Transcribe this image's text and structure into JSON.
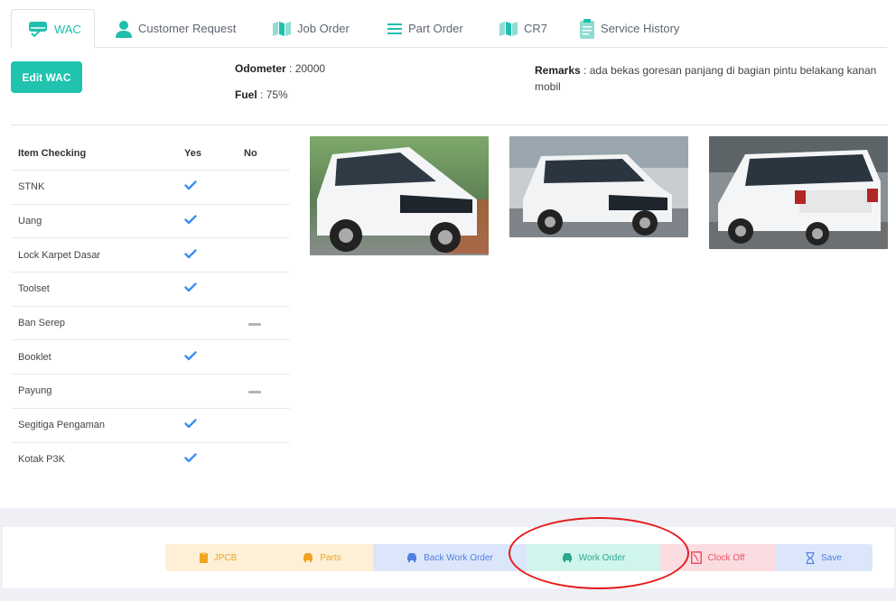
{
  "tabs": [
    {
      "label": "WAC",
      "icon": "car-check-icon",
      "active": true
    },
    {
      "label": "Customer Request",
      "icon": "person-icon"
    },
    {
      "label": "Job Order",
      "icon": "map-icon"
    },
    {
      "label": "Part Order",
      "icon": "list-icon"
    },
    {
      "label": "CR7",
      "icon": "map-icon"
    },
    {
      "label": "Service History",
      "icon": "clipboard-icon"
    }
  ],
  "edit_button": "Edit WAC",
  "odometer": {
    "label": "Odometer",
    "value": "20000"
  },
  "fuel": {
    "label": "Fuel",
    "value": "75%"
  },
  "remarks": {
    "label": "Remarks",
    "value": "ada bekas goresan panjang di bagian pintu belakang kanan mobil"
  },
  "checklist": {
    "headers": {
      "item": "Item Checking",
      "yes": "Yes",
      "no": "No"
    },
    "rows": [
      {
        "item": "STNK",
        "status": "yes"
      },
      {
        "item": "Uang",
        "status": "yes"
      },
      {
        "item": "Lock Karpet Dasar",
        "status": "yes"
      },
      {
        "item": "Toolset",
        "status": "yes"
      },
      {
        "item": "Ban Serep",
        "status": "no"
      },
      {
        "item": "Booklet",
        "status": "yes"
      },
      {
        "item": "Payung",
        "status": "no"
      },
      {
        "item": "Segitiga Pengaman",
        "status": "yes"
      },
      {
        "item": "Kotak P3K",
        "status": "yes"
      }
    ]
  },
  "footer_buttons": {
    "jpcb": "JPCB",
    "parts": "Parts",
    "back_work_order": "Back Work Order",
    "work_order": "Work Order",
    "clock_off": "Clock Off",
    "save": "Save"
  },
  "colors": {
    "accent": "#1fc3ae",
    "check": "#3d8ef0",
    "annotation": "#e41b1b"
  }
}
